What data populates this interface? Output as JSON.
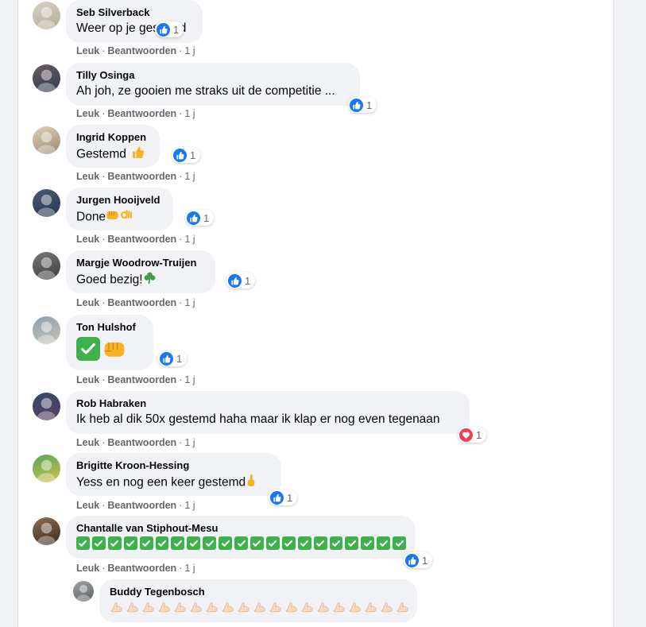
{
  "comments": [
    {
      "author": "Seb Silverback",
      "text": "Weer op je gestemd",
      "emoji": [],
      "reaction": {
        "icon": "like-icon",
        "count": "1"
      },
      "actions": {
        "like": "Leuk",
        "reply": "Beantwoorden",
        "time": "1 j"
      }
    },
    {
      "author": "Tilly Osinga",
      "text": "Ah joh, ze gooien me straks uit de competitie ...",
      "emoji": [],
      "reaction": {
        "icon": "like-icon",
        "count": "1"
      },
      "actions": {
        "like": "Leuk",
        "reply": "Beantwoorden",
        "time": "1 j"
      }
    },
    {
      "author": "Ingrid Koppen",
      "text": "Gestemd",
      "emoji": [
        "thumbs-up-emoji"
      ],
      "reaction": {
        "icon": "like-icon",
        "count": "1"
      },
      "actions": {
        "like": "Leuk",
        "reply": "Beantwoorden",
        "time": "1 j"
      }
    },
    {
      "author": "Jurgen Hooijveld",
      "text": "Done",
      "emoji": [
        "fist-emoji",
        "ok-hand-emoji"
      ],
      "reaction": {
        "icon": "like-icon",
        "count": "1"
      },
      "actions": {
        "like": "Leuk",
        "reply": "Beantwoorden",
        "time": "1 j"
      }
    },
    {
      "author": "Margje Woodrow-Truijen",
      "text": "Goed bezig!",
      "emoji": [
        "clover-emoji"
      ],
      "reaction": {
        "icon": "like-icon",
        "count": "1"
      },
      "actions": {
        "like": "Leuk",
        "reply": "Beantwoorden",
        "time": "1 j"
      }
    },
    {
      "author": "Ton Hulshof",
      "text": "",
      "emoji": [
        "check-mark-emoji",
        "fist-emoji"
      ],
      "reaction": {
        "icon": "like-icon",
        "count": "1"
      },
      "actions": {
        "like": "Leuk",
        "reply": "Beantwoorden",
        "time": "1 j"
      }
    },
    {
      "author": "Rob Habraken",
      "text": "Ik heb al dik 50x gestemd haha maar ik klap er nog even tegenaan",
      "emoji": [],
      "reaction": {
        "icon": "love-icon",
        "count": "1"
      },
      "actions": {
        "like": "Leuk",
        "reply": "Beantwoorden",
        "time": "1 j"
      }
    },
    {
      "author": "Brigitte Kroon-Hessing",
      "text": "Yess en nog een keer gestemd",
      "emoji": [
        "pointing-up-emoji"
      ],
      "reaction": {
        "icon": "like-icon",
        "count": "1"
      },
      "actions": {
        "like": "Leuk",
        "reply": "Beantwoorden",
        "time": "1 j"
      }
    },
    {
      "author": "Chantalle van Stiphout-Mesu",
      "text": "",
      "emoji": [
        "check-mark-emoji-x21"
      ],
      "reaction": {
        "icon": "like-icon",
        "count": "1"
      },
      "actions": {
        "like": "Leuk",
        "reply": "Beantwoorden",
        "time": "1 j"
      }
    },
    {
      "author": "Buddy Tegenbosch",
      "text": "",
      "emoji": [
        "flexed-biceps-emoji-x19"
      ],
      "reaction": null,
      "actions": null,
      "reply": true
    }
  ],
  "colors": {
    "like": "#1877f2",
    "love": "#f33e58",
    "check": "#3fb14c",
    "bubble": "#f0f2f5"
  }
}
